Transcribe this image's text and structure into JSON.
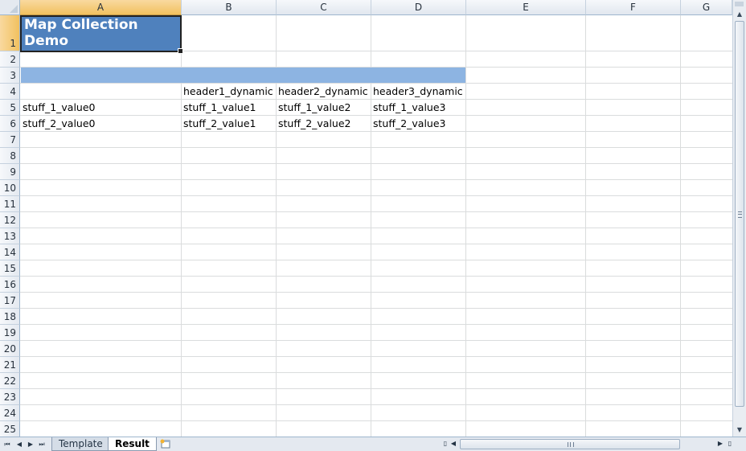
{
  "columns": [
    "A",
    "B",
    "C",
    "D",
    "E",
    "F",
    "G"
  ],
  "rows": [
    "1",
    "2",
    "3",
    "4",
    "5",
    "6",
    "7",
    "8",
    "9",
    "10",
    "11",
    "12",
    "13",
    "14",
    "15",
    "16",
    "17",
    "18",
    "19",
    "20",
    "21",
    "22",
    "23",
    "24",
    "25"
  ],
  "cells": {
    "A1": "Map Collection Demo",
    "B4": "header1_dynamic",
    "C4": "header2_dynamic",
    "D4": "header3_dynamic",
    "A5": "stuff_1_value0",
    "B5": "stuff_1_value1",
    "C5": "stuff_1_value2",
    "D5": "stuff_1_value3",
    "A6": "stuff_2_value0",
    "B6": "stuff_2_value1",
    "C6": "stuff_2_value2",
    "D6": "stuff_2_value3"
  },
  "sheet_tabs": [
    "Template",
    "Result"
  ],
  "active_sheet": "Result",
  "colors": {
    "title_fill": "#4f81bd",
    "band_fill": "#8db4e2",
    "selected_header": "#f1c15f"
  }
}
